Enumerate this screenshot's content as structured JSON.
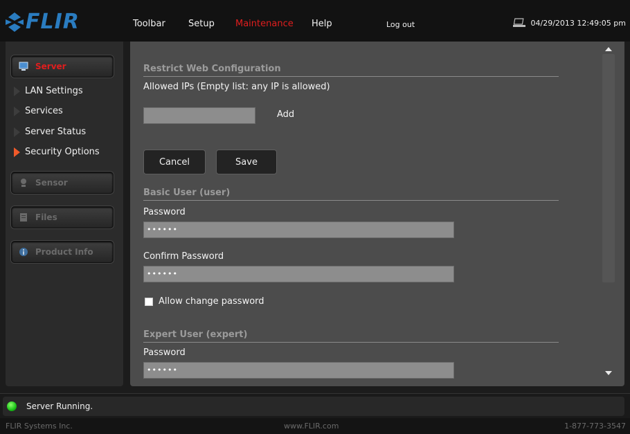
{
  "header": {
    "logo_text": "FLIR",
    "menu": [
      "Toolbar",
      "Setup",
      "Maintenance",
      "Help",
      "Log out"
    ],
    "active_menu": "Maintenance",
    "datetime": "04/29/2013 12:49:05 pm"
  },
  "sidebar": {
    "server_label": "Server",
    "sub_items": [
      "LAN Settings",
      "Services",
      "Server Status",
      "Security Options"
    ],
    "active_sub": "Security Options",
    "sensor_label": "Sensor",
    "files_label": "Files",
    "product_label": "Product Info"
  },
  "restrict": {
    "section_title": "Restrict Web Configuration",
    "allowed_label": "Allowed IPs  (Empty list: any IP is allowed)",
    "ip_value": "",
    "add_label": "Add",
    "cancel_label": "Cancel",
    "save_label": "Save"
  },
  "basic_user": {
    "section_title": "Basic User (user)",
    "password_label": "Password",
    "password_value": "••••••",
    "confirm_label": "Confirm Password",
    "confirm_value": "••••••",
    "allow_change_label": "Allow change password",
    "allow_change_checked": false
  },
  "expert_user": {
    "section_title": "Expert User (expert)",
    "password_label": "Password",
    "password_value": "••••••"
  },
  "status": {
    "text": "Server Running.",
    "color": "#19c017"
  },
  "footer": {
    "left": "FLIR Systems Inc.",
    "center": "www.FLIR.com",
    "right": "1-877-773-3547"
  },
  "colors": {
    "brand": "#2a7cc0",
    "active": "#e01e1e",
    "active_arrow": "#f05a2a"
  },
  "icons": [
    "flir-logo-icon",
    "monitor-icon",
    "webcam-icon",
    "file-icon",
    "info-icon",
    "network-icon"
  ]
}
